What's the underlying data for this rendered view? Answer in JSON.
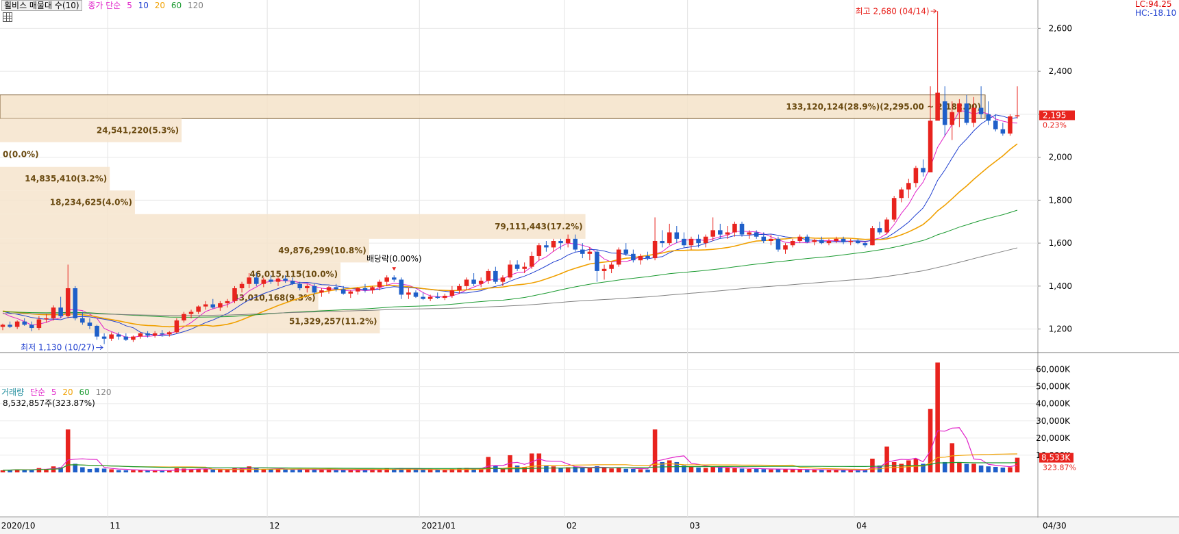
{
  "legend": {
    "title": "휠비스 매물대 수(10)",
    "price_ma_label": "종가 단순",
    "ma_periods": [
      "5",
      "10",
      "20",
      "60",
      "120"
    ],
    "volume_label": "거래량",
    "volume_ma_label": "단순",
    "volume_ma_periods": [
      "5",
      "20",
      "60",
      "120"
    ]
  },
  "colors": {
    "up": "#e8231e",
    "down": "#1f5fc9",
    "ma5": "#e020c8",
    "ma10": "#1f3fd0",
    "ma20": "#f0a000",
    "ma60": "#1a9a30",
    "ma120": "#808080",
    "profile": "#f6e4cc",
    "volume_ma5": "#e020c8",
    "volume_ma20": "#f0a000",
    "volume_ma60": "#1a9a30"
  },
  "top_right": {
    "lc": "LC:94.25",
    "hc": "HC:-18.10"
  },
  "current": {
    "price": "2,195",
    "change": "0.23%",
    "volume": "8,533K",
    "volume_ratio": "323.87%"
  },
  "volume_now": "8,532,857주(323.87%)",
  "annotations": {
    "high": "최고 2,680 (04/14)",
    "low": "최저 1,130 (10/27)",
    "ex_dividend": "배당락(0.00%)"
  },
  "x_labels": [
    "2020/10",
    "11",
    "12",
    "2021/01",
    "02",
    "03",
    "04"
  ],
  "last_date": "04/30",
  "chart_data": {
    "type": "candlestick",
    "title": "휠비스 매물대 수(10)",
    "price_axis": {
      "min": 1100,
      "max": 2700,
      "ticks": [
        "1,200",
        "1,400",
        "1,600",
        "1,800",
        "2,000",
        "2,200",
        "2,400",
        "2,600"
      ]
    },
    "volume_axis": {
      "unit": "K",
      "max": 65000,
      "ticks": [
        "10,000K",
        "20,000K",
        "30,000K",
        "40,000K",
        "50,000K",
        "60,000K"
      ]
    },
    "volume_profile": [
      {
        "low": 2180,
        "high": 2290,
        "label": "133,120,124(28.9%)(2,295.00 ~ 2,182.00)",
        "value": 133120124
      },
      {
        "low": 2070,
        "high": 2180,
        "label": "24,541,220(5.3%)",
        "value": 24541220
      },
      {
        "low": 1955,
        "high": 2070,
        "label": "0(0.0%)",
        "value": 0
      },
      {
        "low": 1845,
        "high": 1955,
        "label": "14,835,410(3.2%)",
        "value": 14835410
      },
      {
        "low": 1735,
        "high": 1845,
        "label": "18,234,625(4.0%)",
        "value": 18234625
      },
      {
        "low": 1620,
        "high": 1735,
        "label": "79,111,443(17.2%)",
        "value": 79111443
      },
      {
        "low": 1510,
        "high": 1620,
        "label": "49,876,299(10.8%)",
        "value": 49876299
      },
      {
        "low": 1400,
        "high": 1510,
        "label": "46,015,115(10.0%)",
        "value": 46015115
      },
      {
        "low": 1290,
        "high": 1400,
        "label": "43,010,168(9.3%)",
        "value": 43010168
      },
      {
        "low": 1180,
        "high": 1290,
        "label": "51,329,257(11.2%)",
        "value": 51329257
      }
    ],
    "series": [
      {
        "name": "5",
        "values": []
      },
      {
        "name": "10",
        "values": []
      },
      {
        "name": "20",
        "values": []
      },
      {
        "name": "60",
        "values": []
      },
      {
        "name": "120",
        "values": []
      }
    ],
    "candles": [
      [
        1210,
        1225,
        1195,
        1220,
        1200
      ],
      [
        1220,
        1235,
        1205,
        1210,
        1500
      ],
      [
        1210,
        1240,
        1200,
        1235,
        1800
      ],
      [
        1235,
        1250,
        1215,
        1220,
        1400
      ],
      [
        1220,
        1235,
        1190,
        1205,
        1700
      ],
      [
        1205,
        1260,
        1195,
        1245,
        2500
      ],
      [
        1245,
        1270,
        1230,
        1250,
        2000
      ],
      [
        1250,
        1310,
        1240,
        1300,
        3500
      ],
      [
        1300,
        1350,
        1250,
        1260,
        3000
      ],
      [
        1260,
        1500,
        1250,
        1390,
        25000
      ],
      [
        1390,
        1400,
        1240,
        1250,
        5000
      ],
      [
        1250,
        1280,
        1220,
        1230,
        3000
      ],
      [
        1230,
        1250,
        1200,
        1215,
        2000
      ],
      [
        1215,
        1220,
        1150,
        1165,
        2500
      ],
      [
        1165,
        1180,
        1130,
        1155,
        2200
      ],
      [
        1155,
        1185,
        1145,
        1175,
        1800
      ],
      [
        1175,
        1185,
        1150,
        1165,
        1300
      ],
      [
        1165,
        1180,
        1145,
        1150,
        1200
      ],
      [
        1150,
        1170,
        1140,
        1165,
        1200
      ],
      [
        1165,
        1185,
        1155,
        1180,
        1200
      ],
      [
        1180,
        1190,
        1160,
        1170,
        1000
      ],
      [
        1170,
        1190,
        1160,
        1180,
        1100
      ],
      [
        1180,
        1195,
        1165,
        1175,
        1000
      ],
      [
        1175,
        1190,
        1165,
        1185,
        1200
      ],
      [
        1185,
        1250,
        1180,
        1240,
        2400
      ],
      [
        1240,
        1280,
        1230,
        1270,
        2200
      ],
      [
        1270,
        1290,
        1250,
        1280,
        1800
      ],
      [
        1280,
        1310,
        1270,
        1305,
        2000
      ],
      [
        1305,
        1330,
        1290,
        1315,
        1900
      ],
      [
        1315,
        1340,
        1295,
        1300,
        1600
      ],
      [
        1300,
        1330,
        1285,
        1320,
        1800
      ],
      [
        1320,
        1340,
        1300,
        1330,
        1500
      ],
      [
        1330,
        1400,
        1320,
        1390,
        2500
      ],
      [
        1390,
        1420,
        1370,
        1410,
        2800
      ],
      [
        1410,
        1460,
        1390,
        1440,
        3500
      ],
      [
        1440,
        1460,
        1400,
        1410,
        2500
      ],
      [
        1410,
        1440,
        1395,
        1430,
        2000
      ],
      [
        1430,
        1450,
        1410,
        1420,
        1800
      ],
      [
        1420,
        1440,
        1400,
        1435,
        2000
      ],
      [
        1435,
        1450,
        1415,
        1425,
        1700
      ],
      [
        1425,
        1440,
        1405,
        1410,
        1500
      ],
      [
        1410,
        1420,
        1380,
        1390,
        1800
      ],
      [
        1390,
        1410,
        1370,
        1400,
        1600
      ],
      [
        1400,
        1410,
        1360,
        1370,
        1700
      ],
      [
        1370,
        1390,
        1350,
        1380,
        1500
      ],
      [
        1380,
        1400,
        1365,
        1395,
        1400
      ],
      [
        1395,
        1410,
        1375,
        1385,
        1300
      ],
      [
        1385,
        1400,
        1360,
        1365,
        1400
      ],
      [
        1365,
        1380,
        1345,
        1375,
        1300
      ],
      [
        1375,
        1395,
        1360,
        1390,
        1400
      ],
      [
        1390,
        1410,
        1370,
        1380,
        1500
      ],
      [
        1380,
        1400,
        1365,
        1395,
        1700
      ],
      [
        1395,
        1430,
        1380,
        1420,
        2000
      ],
      [
        1420,
        1450,
        1400,
        1440,
        2200
      ],
      [
        1440,
        1450,
        1420,
        1430,
        1800
      ],
      [
        1430,
        1440,
        1340,
        1360,
        2500
      ],
      [
        1360,
        1390,
        1340,
        1370,
        2000
      ],
      [
        1370,
        1380,
        1345,
        1350,
        1700
      ],
      [
        1350,
        1370,
        1335,
        1340,
        1600
      ],
      [
        1340,
        1360,
        1330,
        1350,
        1500
      ],
      [
        1350,
        1370,
        1340,
        1345,
        1400
      ],
      [
        1345,
        1365,
        1335,
        1355,
        1300
      ],
      [
        1355,
        1400,
        1345,
        1380,
        2000
      ],
      [
        1380,
        1410,
        1365,
        1400,
        2200
      ],
      [
        1400,
        1440,
        1380,
        1430,
        2600
      ],
      [
        1430,
        1460,
        1400,
        1410,
        2400
      ],
      [
        1410,
        1440,
        1395,
        1425,
        2000
      ],
      [
        1425,
        1480,
        1410,
        1470,
        9000
      ],
      [
        1470,
        1490,
        1410,
        1420,
        4000
      ],
      [
        1420,
        1450,
        1400,
        1440,
        2400
      ],
      [
        1440,
        1520,
        1430,
        1500,
        10000
      ],
      [
        1500,
        1520,
        1470,
        1480,
        4000
      ],
      [
        1480,
        1510,
        1460,
        1490,
        3000
      ],
      [
        1490,
        1560,
        1480,
        1540,
        11000
      ],
      [
        1540,
        1600,
        1520,
        1590,
        11000
      ],
      [
        1590,
        1610,
        1560,
        1580,
        4000
      ],
      [
        1580,
        1620,
        1560,
        1610,
        3500
      ],
      [
        1610,
        1620,
        1570,
        1600,
        2800
      ],
      [
        1600,
        1640,
        1580,
        1620,
        3000
      ],
      [
        1620,
        1640,
        1560,
        1570,
        3300
      ],
      [
        1570,
        1600,
        1530,
        1550,
        2600
      ],
      [
        1550,
        1580,
        1520,
        1560,
        2400
      ],
      [
        1560,
        1570,
        1420,
        1470,
        3600
      ],
      [
        1470,
        1500,
        1430,
        1480,
        2800
      ],
      [
        1480,
        1510,
        1460,
        1500,
        2300
      ],
      [
        1500,
        1580,
        1490,
        1570,
        2800
      ],
      [
        1570,
        1600,
        1540,
        1550,
        2100
      ],
      [
        1550,
        1570,
        1510,
        1520,
        2000
      ],
      [
        1520,
        1550,
        1500,
        1540,
        1800
      ],
      [
        1540,
        1560,
        1520,
        1530,
        1600
      ],
      [
        1530,
        1720,
        1520,
        1610,
        25000
      ],
      [
        1610,
        1660,
        1580,
        1600,
        6000
      ],
      [
        1600,
        1690,
        1590,
        1650,
        7000
      ],
      [
        1650,
        1680,
        1600,
        1620,
        6000
      ],
      [
        1620,
        1650,
        1580,
        1590,
        4000
      ],
      [
        1590,
        1630,
        1570,
        1620,
        3500
      ],
      [
        1620,
        1640,
        1580,
        1600,
        2800
      ],
      [
        1600,
        1640,
        1580,
        1630,
        2600
      ],
      [
        1630,
        1720,
        1610,
        1660,
        3300
      ],
      [
        1660,
        1690,
        1620,
        1640,
        2800
      ],
      [
        1640,
        1680,
        1620,
        1650,
        2600
      ],
      [
        1650,
        1700,
        1630,
        1690,
        2400
      ],
      [
        1690,
        1700,
        1630,
        1640,
        2200
      ],
      [
        1640,
        1660,
        1620,
        1650,
        2000
      ],
      [
        1650,
        1660,
        1620,
        1630,
        2100
      ],
      [
        1630,
        1650,
        1600,
        1610,
        1900
      ],
      [
        1610,
        1640,
        1590,
        1620,
        1700
      ],
      [
        1620,
        1630,
        1560,
        1570,
        2000
      ],
      [
        1570,
        1600,
        1550,
        1590,
        1800
      ],
      [
        1590,
        1620,
        1580,
        1610,
        1700
      ],
      [
        1610,
        1640,
        1600,
        1630,
        1600
      ],
      [
        1630,
        1640,
        1600,
        1605,
        1500
      ],
      [
        1605,
        1620,
        1590,
        1615,
        1400
      ],
      [
        1615,
        1630,
        1595,
        1600,
        1500
      ],
      [
        1600,
        1620,
        1590,
        1610,
        1400
      ],
      [
        1610,
        1630,
        1600,
        1620,
        1300
      ],
      [
        1620,
        1630,
        1595,
        1605,
        1300
      ],
      [
        1605,
        1620,
        1590,
        1610,
        1200
      ],
      [
        1610,
        1620,
        1595,
        1600,
        1200
      ],
      [
        1600,
        1610,
        1580,
        1590,
        1300
      ],
      [
        1590,
        1680,
        1590,
        1670,
        8000
      ],
      [
        1670,
        1700,
        1640,
        1650,
        4000
      ],
      [
        1650,
        1720,
        1640,
        1710,
        15000
      ],
      [
        1710,
        1820,
        1700,
        1810,
        6000
      ],
      [
        1810,
        1860,
        1790,
        1850,
        5000
      ],
      [
        1850,
        1900,
        1810,
        1880,
        7000
      ],
      [
        1880,
        1960,
        1860,
        1950,
        8000
      ],
      [
        1950,
        1990,
        1910,
        1930,
        5000
      ],
      [
        1930,
        2330,
        2050,
        2170,
        37000
      ],
      [
        2170,
        2680,
        2200,
        2300,
        64000
      ],
      [
        2260,
        2330,
        2100,
        2150,
        6000
      ],
      [
        2150,
        2260,
        2080,
        2210,
        17000
      ],
      [
        2210,
        2270,
        2140,
        2250,
        6000
      ],
      [
        2250,
        2290,
        2150,
        2160,
        5000
      ],
      [
        2160,
        2280,
        2140,
        2230,
        5000
      ],
      [
        2230,
        2330,
        2180,
        2200,
        4000
      ],
      [
        2200,
        2260,
        2150,
        2170,
        3500
      ],
      [
        2170,
        2200,
        2120,
        2130,
        3200
      ],
      [
        2130,
        2160,
        2100,
        2110,
        2800
      ],
      [
        2110,
        2200,
        2100,
        2190,
        3000
      ],
      [
        2190,
        2330,
        2180,
        2195,
        8533
      ]
    ]
  }
}
